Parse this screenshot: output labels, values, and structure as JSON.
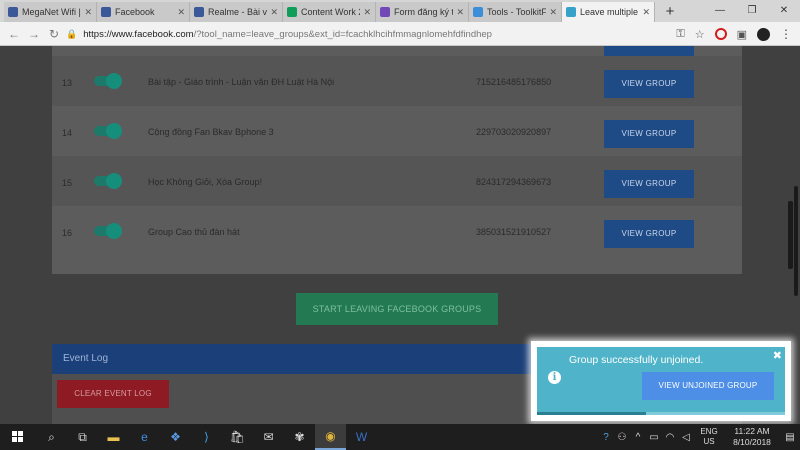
{
  "browser": {
    "tabs": [
      {
        "title": "MegaNet Wifi |",
        "color": "#3b5998",
        "active": false
      },
      {
        "title": "Facebook",
        "color": "#3b5998",
        "active": false
      },
      {
        "title": "Realme - Bài vi",
        "color": "#3b5998",
        "active": false
      },
      {
        "title": "Content Work 2",
        "color": "#0f9d58",
        "active": false
      },
      {
        "title": "Form đăng ký t",
        "color": "#7248b9",
        "active": false
      },
      {
        "title": "Tools - ToolkitF",
        "color": "#3a8fd8",
        "active": false
      },
      {
        "title": "Leave multiple",
        "color": "#36a2c9",
        "active": true
      }
    ],
    "url_host": "https://www.facebook.com",
    "url_rest": "/?tool_name=leave_groups&ext_id=fcachklhcihfmmagnlomehfdfindhep"
  },
  "groups": {
    "rows": [
      {
        "num": "13",
        "name": "Bài tập - Giáo trình - Luận văn ĐH Luật Hà Nội",
        "id": "715216485176850",
        "button": "VIEW GROUP"
      },
      {
        "num": "14",
        "name": "Cộng đồng Fan Bkav Bphone 3",
        "id": "229703020920897",
        "button": "VIEW GROUP"
      },
      {
        "num": "15",
        "name": "Học Không Giỏi, Xóa Group!",
        "id": "824317294369673",
        "button": "VIEW GROUP"
      },
      {
        "num": "16",
        "name": "Group Cao thủ đàn hát",
        "id": "385031521910527",
        "button": "VIEW GROUP"
      }
    ]
  },
  "actions": {
    "start_label": "START LEAVING FACEBOOK GROUPS"
  },
  "event_log": {
    "title": "Event Log",
    "clear_label": "CLEAR EVENT LOG"
  },
  "toast": {
    "message": "Group successfully unjoined.",
    "button": "VIEW UNJOINED GROUP",
    "close": "✖",
    "progress": 0.44
  },
  "taskbar": {
    "lang_line1": "ENG",
    "lang_line2": "US",
    "time": "11:22 AM",
    "date": "8/10/2018"
  },
  "colors": {
    "toast_bg": "#4fb4c9",
    "view_group_btn": "#1e4a86",
    "start_btn": "#237a52",
    "clear_btn": "#8e1b24",
    "event_log_header": "#1b3f78"
  }
}
